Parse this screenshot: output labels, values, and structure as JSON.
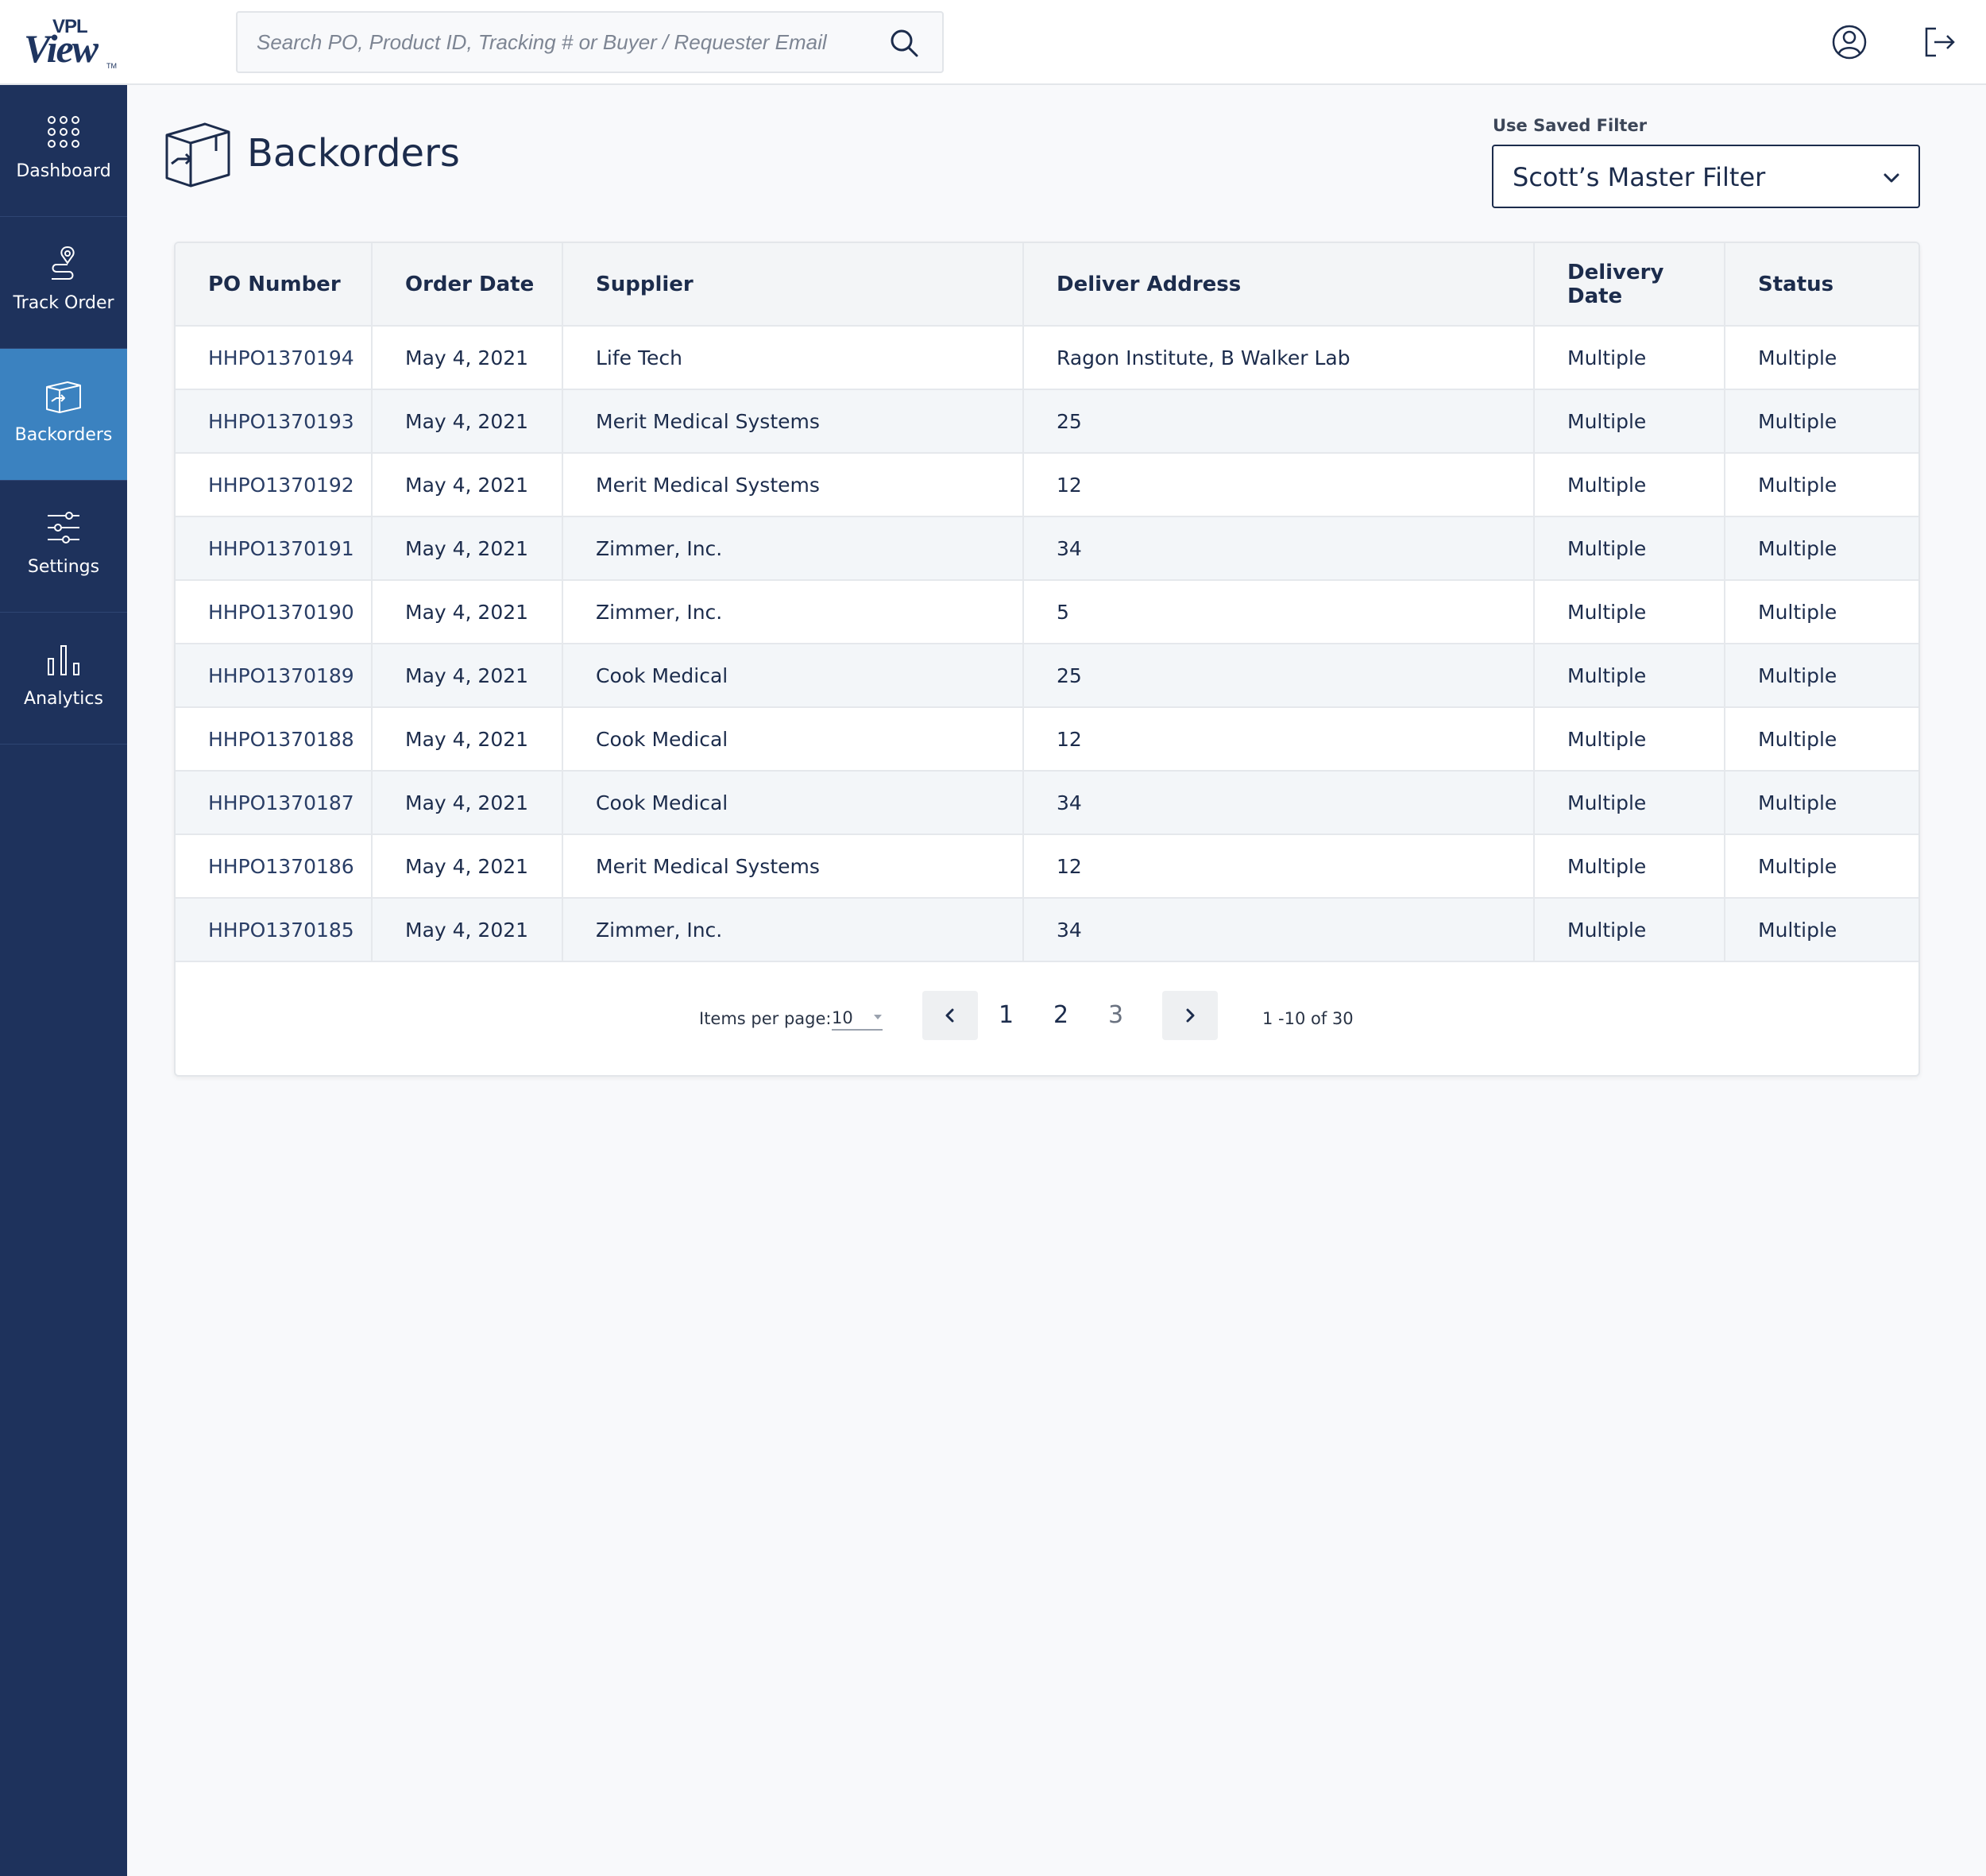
{
  "app": {
    "logo_brand": "VPL",
    "logo_name": "View",
    "logo_tm": "TM"
  },
  "search": {
    "placeholder": "Search PO, Product ID, Tracking # or Buyer / Requester Email",
    "icon": "search-icon"
  },
  "header_icons": [
    "user-profile-icon",
    "logout-icon"
  ],
  "sidebar": {
    "items": [
      {
        "label": "Dashboard",
        "icon": "grid-dots-icon",
        "active": false
      },
      {
        "label": "Track Order",
        "icon": "route-pin-icon",
        "active": false
      },
      {
        "label": "Backorders",
        "icon": "box-icon",
        "active": true
      },
      {
        "label": "Settings",
        "icon": "sliders-icon",
        "active": false
      },
      {
        "label": "Analytics",
        "icon": "bar-chart-icon",
        "active": false
      }
    ]
  },
  "page": {
    "title": "Backorders",
    "icon": "box-arrow-icon"
  },
  "saved_filter": {
    "label": "Use Saved Filter",
    "value": "Scott’s Master Filter"
  },
  "table": {
    "columns": [
      "PO Number",
      "Order Date",
      "Supplier",
      "Deliver Address",
      "Delivery Date",
      "Status"
    ],
    "rows": [
      [
        "HHPO1370194",
        "May 4, 2021",
        "Life Tech",
        "Ragon Institute, B Walker Lab",
        "Multiple",
        "Multiple"
      ],
      [
        "HHPO1370193",
        "May 4, 2021",
        "Merit Medical Systems",
        "25",
        "Multiple",
        "Multiple"
      ],
      [
        "HHPO1370192",
        "May 4, 2021",
        "Merit Medical Systems",
        "12",
        "Multiple",
        "Multiple"
      ],
      [
        "HHPO1370191",
        "May 4, 2021",
        "Zimmer, Inc.",
        "34",
        "Multiple",
        "Multiple"
      ],
      [
        "HHPO1370190",
        "May 4, 2021",
        "Zimmer, Inc.",
        "5",
        "Multiple",
        "Multiple"
      ],
      [
        "HHPO1370189",
        "May 4, 2021",
        "Cook Medical",
        "25",
        "Multiple",
        "Multiple"
      ],
      [
        "HHPO1370188",
        "May 4, 2021",
        "Cook Medical",
        "12",
        "Multiple",
        "Multiple"
      ],
      [
        "HHPO1370187",
        "May 4, 2021",
        "Cook Medical",
        "34",
        "Multiple",
        "Multiple"
      ],
      [
        "HHPO1370186",
        "May 4, 2021",
        "Merit Medical Systems",
        "12",
        "Multiple",
        "Multiple"
      ],
      [
        "HHPO1370185",
        "May 4, 2021",
        "Zimmer, Inc.",
        "34",
        "Multiple",
        "Multiple"
      ]
    ]
  },
  "pagination": {
    "items_per_page_label": "Items per page:",
    "items_per_page": "10",
    "pages": [
      "1",
      "2",
      "3"
    ],
    "range_text": "1 -10 of 30"
  },
  "colors": {
    "sidebar_bg": "#1e325c",
    "sidebar_active": "#3b82c0",
    "text_primary": "#1c2c4c"
  }
}
